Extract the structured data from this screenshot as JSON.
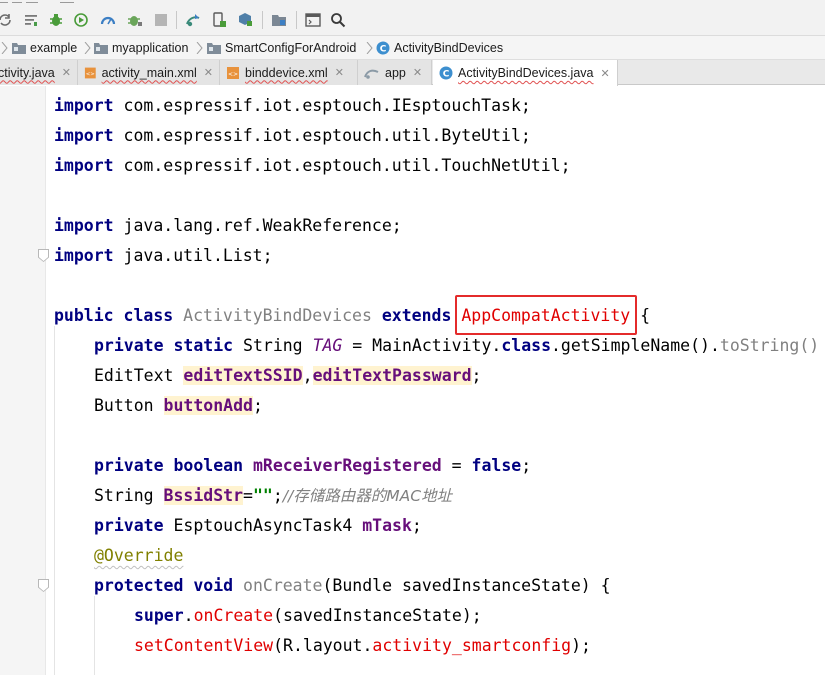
{
  "toolbar": {
    "icons": [
      "sync-icon",
      "structure-icon",
      "debug-icon",
      "run-icon",
      "profile-icon",
      "attach-debugger-icon",
      "stop-icon",
      "sync-gradle-icon",
      "avd-manager-icon",
      "sdk-manager-icon",
      "project-structure-icon",
      "terminal-icon",
      "search-icon"
    ]
  },
  "breadcrumb": {
    "items": [
      "example",
      "myapplication",
      "SmartConfigForAndroid",
      "ActivityBindDevices"
    ]
  },
  "tabs": [
    {
      "label": "ctivity.java",
      "active": false
    },
    {
      "label": "activity_main.xml",
      "active": false
    },
    {
      "label": "binddevice.xml",
      "active": false
    },
    {
      "label": "app",
      "active": false
    },
    {
      "label": "ActivityBindDevices.java",
      "active": true
    }
  ],
  "code": {
    "l1": {
      "kw": "import",
      "rest": " com.espressif.iot.esptouch.IEsptouchTask;"
    },
    "l2": {
      "kw": "import",
      "rest": " com.espressif.iot.esptouch.util.ByteUtil;"
    },
    "l3": {
      "kw": "import",
      "rest": " com.espressif.iot.esptouch.util.TouchNetUtil;"
    },
    "l5": {
      "kw": "import",
      "rest": " java.lang.ref.WeakReference;"
    },
    "l6": {
      "kw": "import",
      "rest": " java.util.List;"
    },
    "l8": {
      "kw1": "public class",
      "name": "ActivityBindDevices",
      "kw2": "extends",
      "parent": "AppCompatActivity",
      "tail": " {"
    },
    "l9": {
      "kw": "private static",
      "type": " String ",
      "tag": "TAG",
      "eq": " = MainActivity.",
      "cls": "class",
      "call": ".getSimpleName().",
      "ts": "toString()"
    },
    "l10": {
      "type": "EditText ",
      "f1": "editTextSSID",
      "comma": ",",
      "f2": "editTextPassward",
      "semi": ";"
    },
    "l11": {
      "type": "Button ",
      "f1": "buttonAdd",
      "semi": ";"
    },
    "l13": {
      "kw": "private boolean",
      "f1": "mReceiverRegistered",
      "eq": " = ",
      "val": "false",
      "semi": ";"
    },
    "l14": {
      "type": "String ",
      "f1": "BssidStr",
      "eq": "=",
      "str": "\"\"",
      "semi": ";",
      "comment": "//存储路由器的MAC地址"
    },
    "l15": {
      "kw": "private",
      "type": " EsptouchAsyncTask4 ",
      "f1": "mTask",
      "semi": ";"
    },
    "l16": {
      "anno": "@Override"
    },
    "l17": {
      "kw": "protected void",
      "method": "onCreate",
      "args": "(Bundle savedInstanceState) {"
    },
    "l18": {
      "kw": "super",
      "dot": ".",
      "method": "onCreate",
      "args": "(savedInstanceState);"
    },
    "l19": {
      "method": "setContentView",
      "args1": "(R.layout.",
      "field": "activity_smartconfig",
      "args2": ");"
    }
  }
}
